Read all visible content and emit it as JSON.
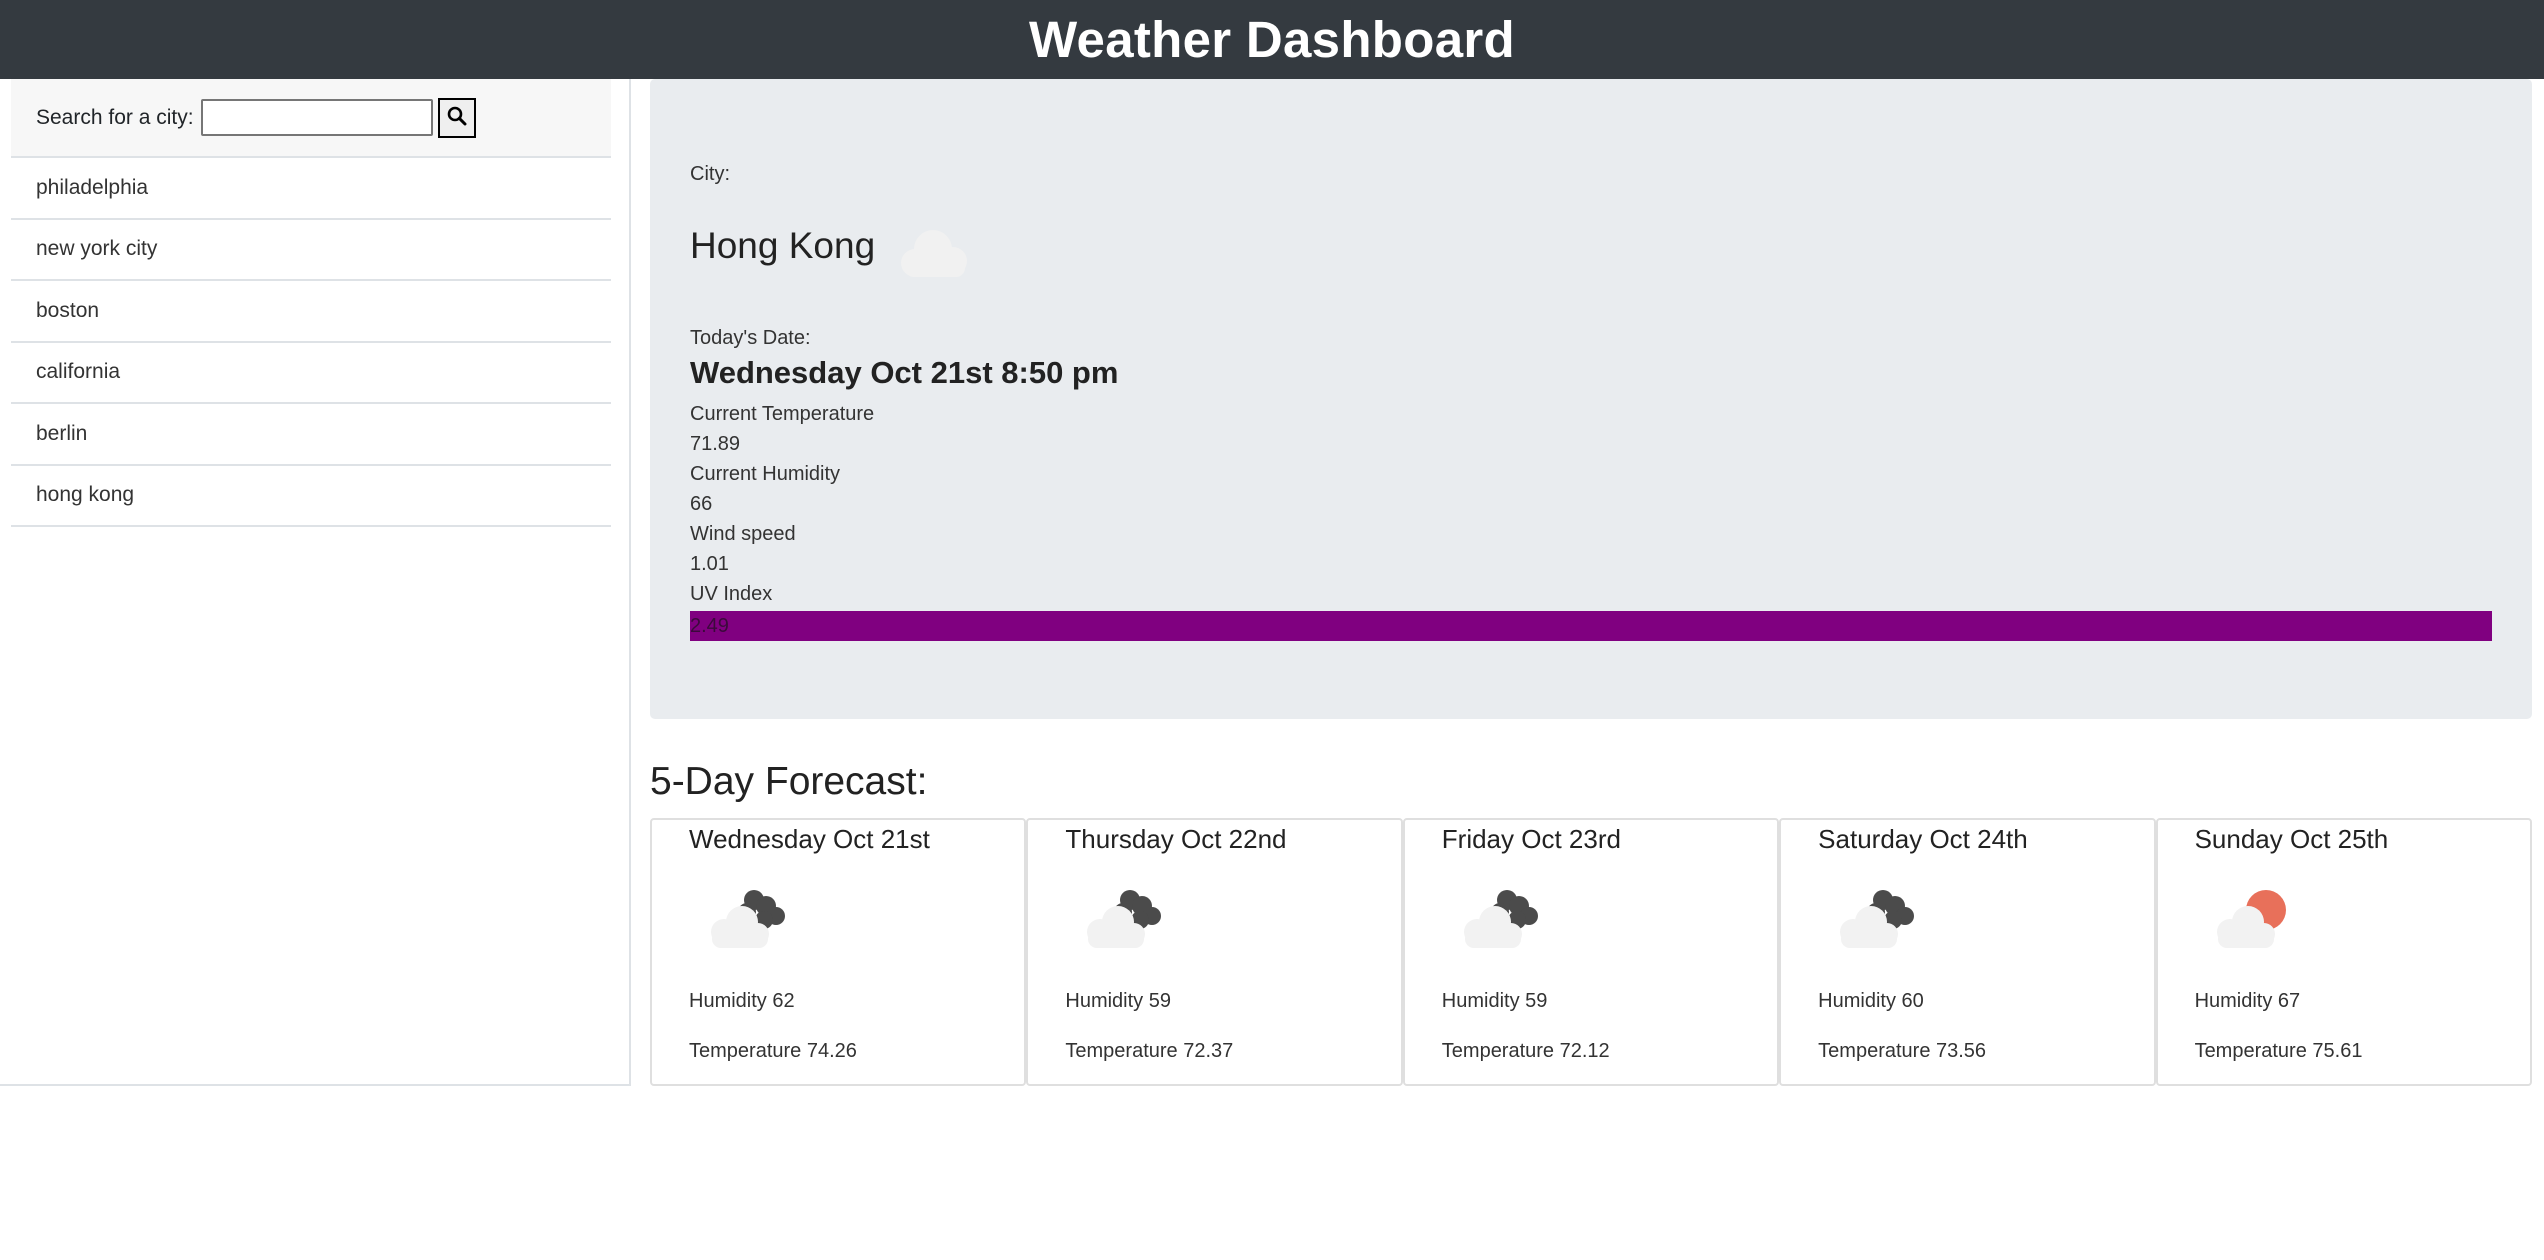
{
  "header": {
    "title": "Weather Dashboard"
  },
  "search": {
    "label": "Search for a city:",
    "value": "",
    "button_icon": "search-icon"
  },
  "history": [
    "philadelphia",
    "new york city",
    "boston",
    "california",
    "berlin",
    "hong kong"
  ],
  "current": {
    "city_label": "City:",
    "city": "Hong Kong",
    "icon": "cloud-icon",
    "date_label": "Today's Date:",
    "date": "Wednesday Oct 21st 8:50 pm",
    "temp_label": "Current Temperature",
    "temp": "71.89",
    "humidity_label": "Current Humidity",
    "humidity": "66",
    "wind_label": "Wind speed",
    "wind": "1.01",
    "uv_label": "UV Index",
    "uv": "2.49",
    "uv_color": "#800080"
  },
  "forecast": {
    "title": "5-Day Forecast:",
    "days": [
      {
        "date": "Wednesday Oct 21st",
        "icon": "cloudy-icon",
        "humidity": "Humidity 62",
        "temp": "Temperature 74.26"
      },
      {
        "date": "Thursday Oct 22nd",
        "icon": "cloudy-icon",
        "humidity": "Humidity 59",
        "temp": "Temperature 72.37"
      },
      {
        "date": "Friday Oct 23rd",
        "icon": "cloudy-icon",
        "humidity": "Humidity 59",
        "temp": "Temperature 72.12"
      },
      {
        "date": "Saturday Oct 24th",
        "icon": "cloudy-icon",
        "humidity": "Humidity 60",
        "temp": "Temperature 73.56"
      },
      {
        "date": "Sunday Oct 25th",
        "icon": "partly-cloudy-icon",
        "humidity": "Humidity 67",
        "temp": "Temperature 75.61"
      }
    ]
  }
}
